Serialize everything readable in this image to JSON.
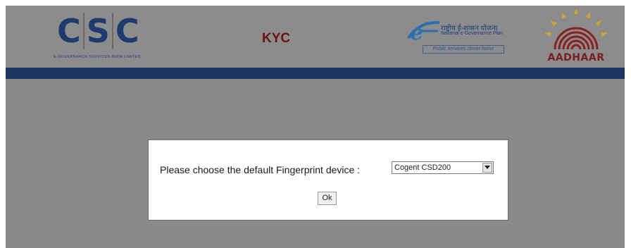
{
  "header": {
    "csc_logo": {
      "letters": [
        "C",
        "S",
        "C"
      ],
      "subtitle": "E-Governance Services India Limited"
    },
    "title": "KYC",
    "egov_logo": {
      "hindi_text": "राष्ट्रीय ई-शासन योजना",
      "english_text": "National e-Governance Plan",
      "tagline": "Public services closer home"
    },
    "aadhaar_logo": {
      "text": "AADHAAR"
    }
  },
  "dialog": {
    "prompt": "Please choose the default Fingerprint device :",
    "device_select": {
      "selected": "Cogent CSD200"
    },
    "ok_label": "Ok"
  },
  "colors": {
    "overlay": "#8a8a8a",
    "header_bar": "#1b3560",
    "title": "#6b1414",
    "csc_blue": "#1d3b6e",
    "aadhaar_red": "#7a1e1e",
    "aadhaar_yellow": "#c9a52a"
  }
}
